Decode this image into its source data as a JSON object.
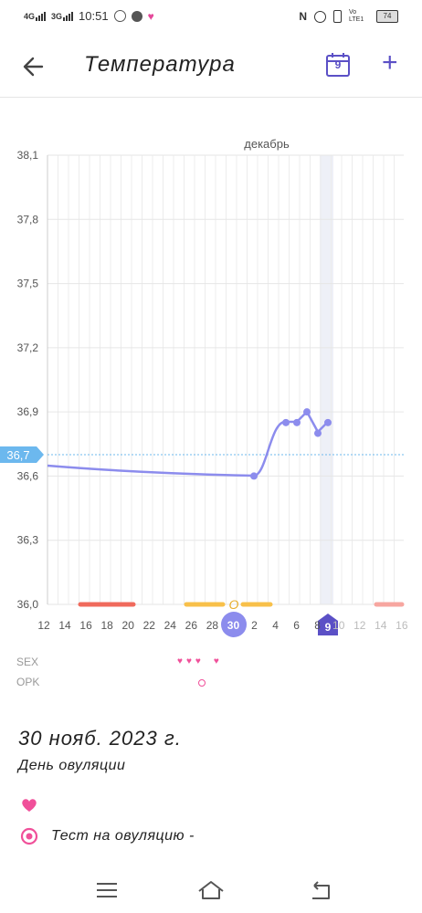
{
  "status_bar": {
    "net1": "4G",
    "net2": "3G",
    "time": "10:51",
    "net3": "Vo LTE1",
    "battery": "74"
  },
  "app_bar": {
    "title": "Температура",
    "calendar_day": "9",
    "add_label": "+"
  },
  "chart_data": {
    "type": "line",
    "month_label": "декабрь",
    "ylim": [
      36.0,
      38.1
    ],
    "y_ticks": [
      "38,1",
      "37,8",
      "37,5",
      "37,2",
      "36,9",
      "36,6",
      "36,3",
      "36,0"
    ],
    "threshold_label": "36,7",
    "threshold_value": 36.7,
    "x_tick_labels": [
      "12",
      "14",
      "16",
      "18",
      "20",
      "22",
      "24",
      "26",
      "28",
      "30",
      "2",
      "4",
      "6",
      "8",
      "10",
      "12",
      "14",
      "16"
    ],
    "selected_x_label": "30",
    "today_label": "9",
    "ovulation_marker": "O",
    "x_points": [
      "30 нояб.",
      "5 дек.",
      "6 дек.",
      "7 дек.",
      "8 дек.",
      "9 дек."
    ],
    "y_points": [
      36.6,
      36.85,
      36.85,
      36.9,
      36.8,
      36.85
    ],
    "line_color": "#8c8ced",
    "period_color": "#f06a5c",
    "fertile_color": "#f8c04a"
  },
  "row_labels": {
    "sex": "SEX",
    "opk": "OPK"
  },
  "detail": {
    "date": "30 нояб. 2023 г.",
    "day_type": "День овуляции",
    "test_label": "Тест на овуляцию -"
  },
  "colors": {
    "accent": "#5b50c6",
    "pink": "#f0509a",
    "threshold": "#6cb8ee"
  }
}
